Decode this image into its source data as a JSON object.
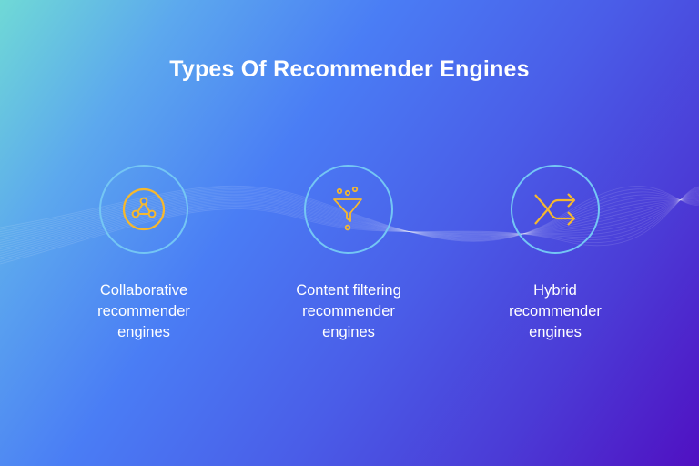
{
  "title": "Types Of Recommender Engines",
  "colors": {
    "icon_accent": "#F5B82E",
    "ring": "#74C6F4",
    "text": "#FFFFFF"
  },
  "items": [
    {
      "icon": "network-triangle-icon",
      "label_lines": [
        "Collaborative",
        "recommender",
        "engines"
      ]
    },
    {
      "icon": "funnel-filter-icon",
      "label_lines": [
        "Content filtering",
        "recommender",
        "engines"
      ]
    },
    {
      "icon": "shuffle-arrows-icon",
      "label_lines": [
        "Hybrid",
        "recommender",
        "engines"
      ]
    }
  ]
}
